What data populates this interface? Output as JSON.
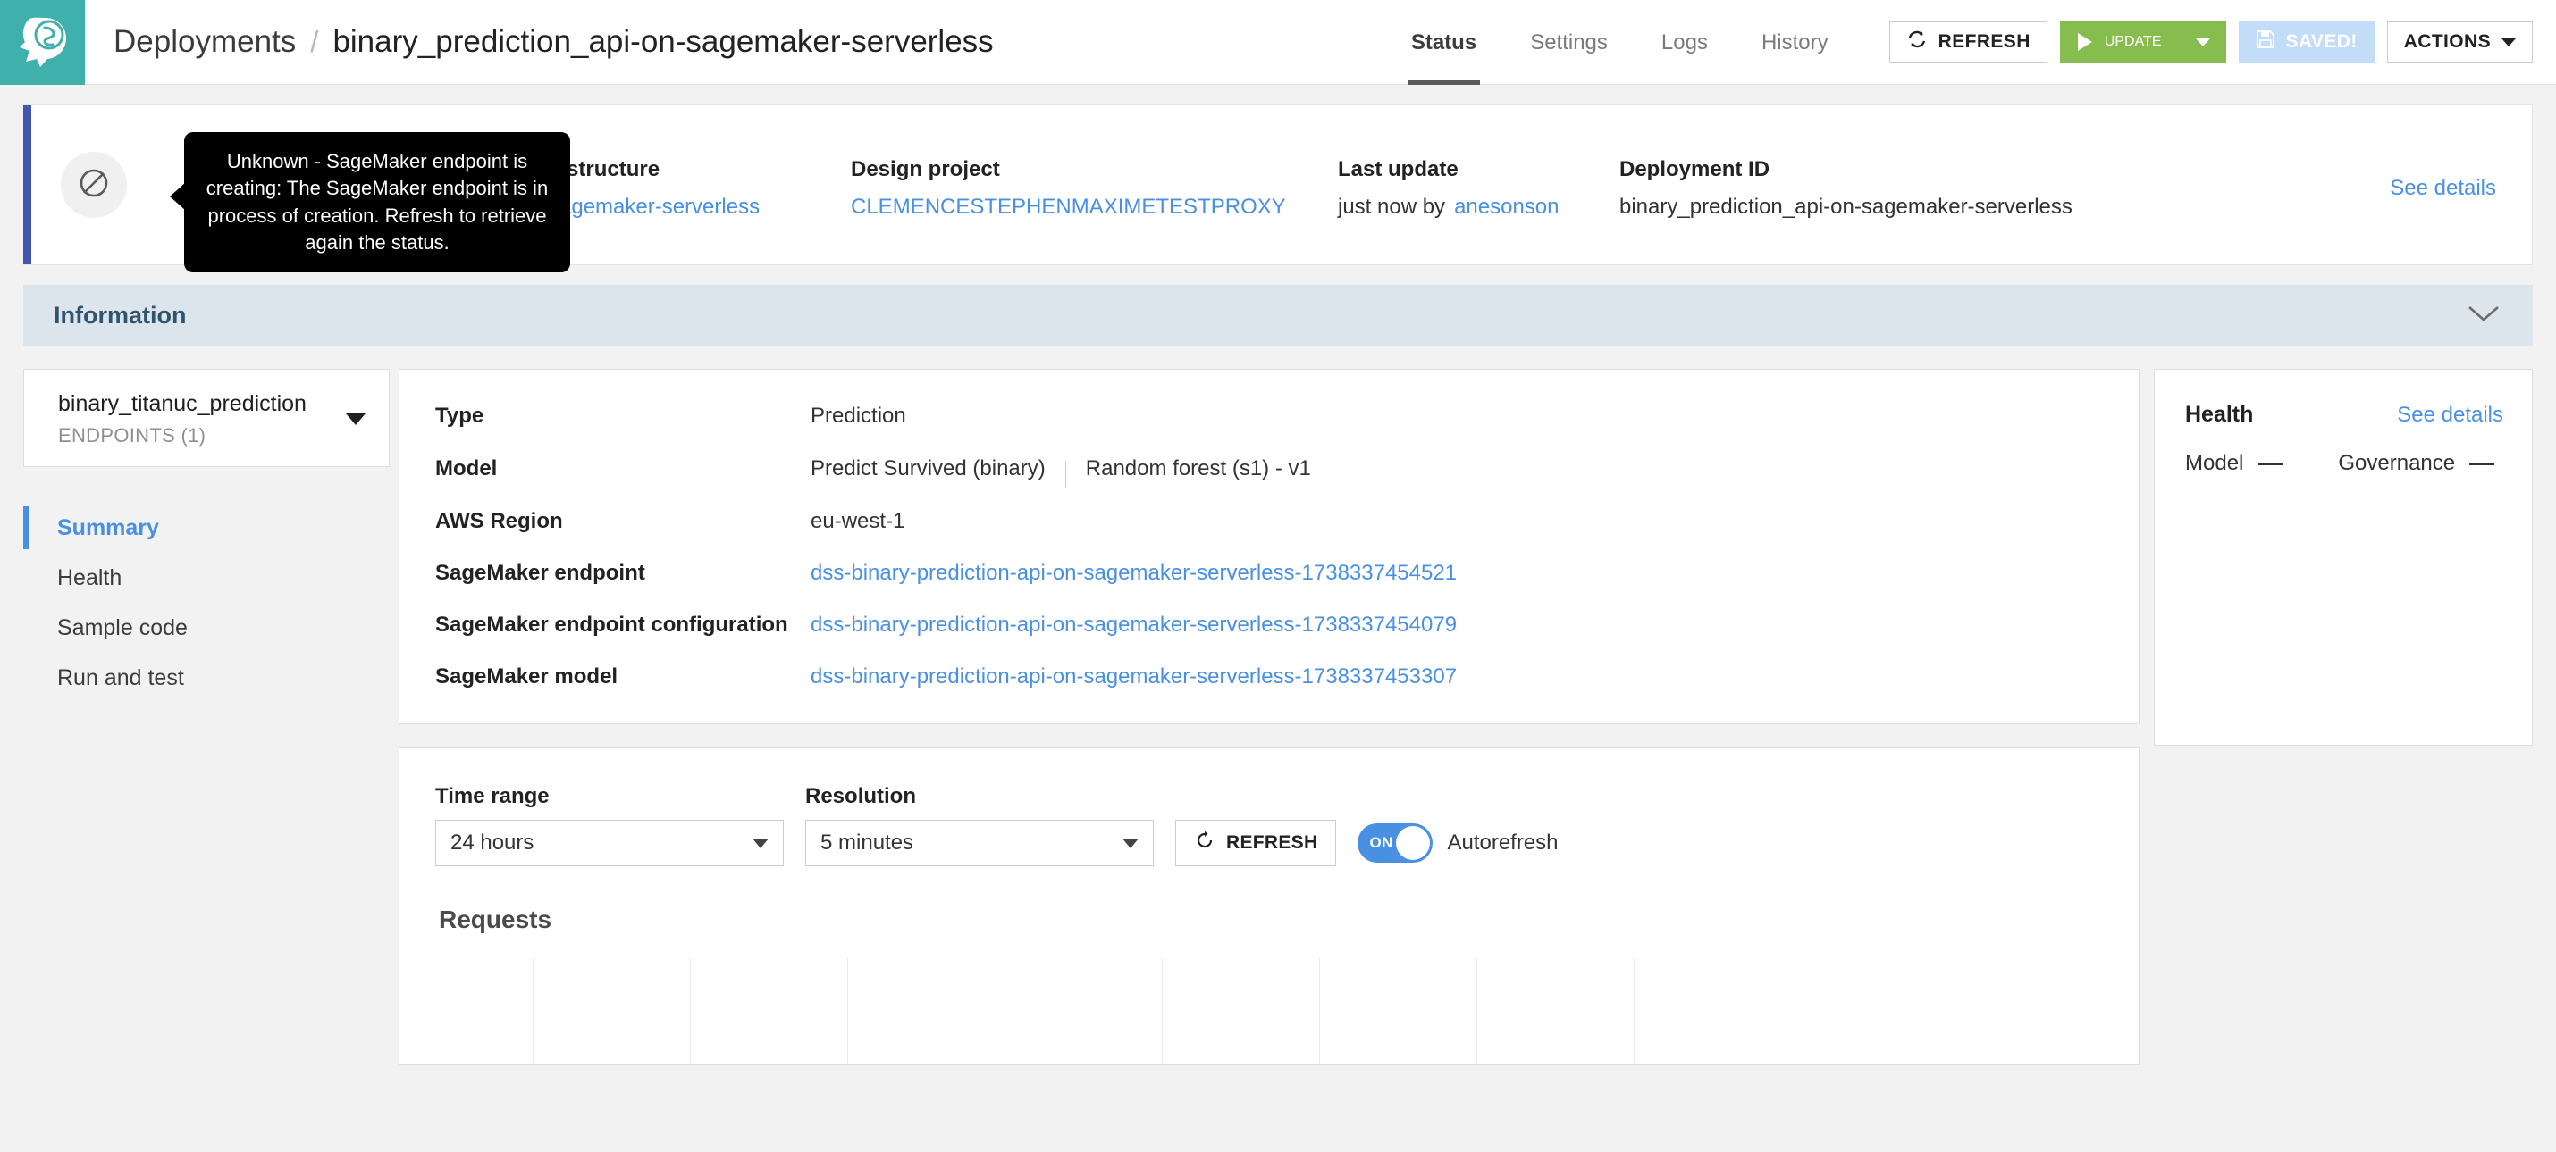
{
  "brand": {
    "logo_name": "dataiku-logo",
    "accent": "#3fb0ac"
  },
  "breadcrumb": {
    "root": "Deployments",
    "separator": "/",
    "title": "binary_prediction_api-on-sagemaker-serverless"
  },
  "tabs": [
    {
      "label": "Status",
      "active": true
    },
    {
      "label": "Settings",
      "active": false
    },
    {
      "label": "Logs",
      "active": false
    },
    {
      "label": "History",
      "active": false
    }
  ],
  "toolbar": {
    "refresh_label": "REFRESH",
    "update_label": "UPDATE",
    "saved_label": "SAVED!",
    "actions_label": "ACTIONS",
    "update_color": "#86bd4e",
    "saved_color": "#c3dcf7"
  },
  "banner": {
    "accent_color": "#4257b2",
    "status_icon": "unknown-slashed-circle-icon",
    "tooltip": "Unknown - SageMaker endpoint is creating: The SageMaker endpoint is in process of creation. Refresh to retrieve again the status.",
    "fields": [
      {
        "label": "Infrastructure",
        "value": "sagemaker-serverless",
        "is_link": true,
        "icon": "brain-icon"
      },
      {
        "label": "Design project",
        "value": "CLEMENCESTEPHENMAXIMETESTPROXY",
        "is_link": true
      },
      {
        "label": "Last update",
        "value": "just now by ",
        "link_value": "anesonson"
      },
      {
        "label": "Deployment ID",
        "value": "binary_prediction_api-on-sagemaker-serverless"
      }
    ],
    "see_details": "See details"
  },
  "information_bar": {
    "title": "Information",
    "collapse_icon": "chevron-down-icon"
  },
  "sidebar": {
    "endpoint_name": "binary_titanuc_prediction",
    "endpoint_sub": "ENDPOINTS (1)",
    "nav": [
      {
        "label": "Summary",
        "active": true
      },
      {
        "label": "Health",
        "active": false
      },
      {
        "label": "Sample code",
        "active": false
      },
      {
        "label": "Run and test",
        "active": false
      }
    ]
  },
  "info_table": {
    "rows": [
      {
        "key": "Type",
        "value": "Prediction"
      },
      {
        "key": "Model",
        "value": "Predict Survived (binary)",
        "value2": "Random forest (s1) - v1"
      },
      {
        "key": "AWS Region",
        "value": "eu-west-1"
      },
      {
        "key": "SageMaker endpoint",
        "value": "dss-binary-prediction-api-on-sagemaker-serverless-1738337454521",
        "is_link": true
      },
      {
        "key": "SageMaker endpoint configuration",
        "value": "dss-binary-prediction-api-on-sagemaker-serverless-1738337454079",
        "is_link": true
      },
      {
        "key": "SageMaker model",
        "value": "dss-binary-prediction-api-on-sagemaker-serverless-1738337453307",
        "is_link": true
      }
    ]
  },
  "health": {
    "title": "Health",
    "see_details": "See details",
    "model_label": "Model",
    "model_value": "—",
    "governance_label": "Governance",
    "governance_value": "—"
  },
  "metrics": {
    "time_range_label": "Time range",
    "time_range_value": "24 hours",
    "resolution_label": "Resolution",
    "resolution_value": "5 minutes",
    "refresh_label": "REFRESH",
    "autorefresh_state": "ON",
    "autorefresh_label": "Autorefresh"
  },
  "chart_data": {
    "type": "line",
    "title": "Requests",
    "series": [
      {
        "name": "Requests",
        "values": []
      }
    ],
    "x": [],
    "xlabel": "",
    "ylabel": "",
    "grid": true,
    "gridlines_x": [
      105,
      281,
      457,
      633,
      809,
      985,
      1161,
      1337
    ],
    "legend": "none",
    "note": "empty chart - no data plotted, vertical gridlines only"
  }
}
